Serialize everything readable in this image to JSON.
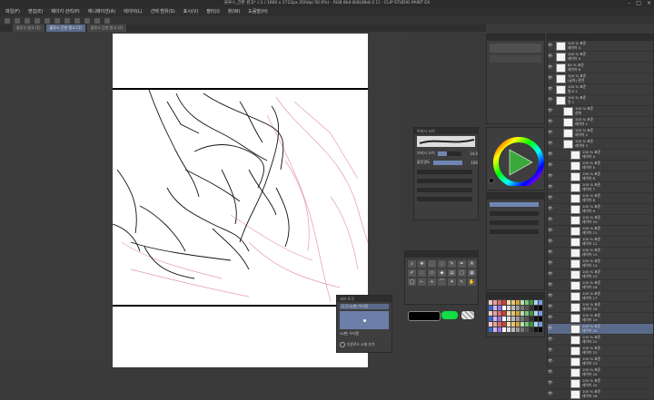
{
  "window": {
    "title": "블루스_간판 원고* (-1 / 1600 x 2712px 350dpi 50.0%) - RGB 8bit B(8)/8bit-2 C) - CLIP STUDIO PAINT EX"
  },
  "menu": [
    "파일(F)",
    "편집(E)",
    "페이지 관리(P)",
    "애니메이션(A)",
    "레이어(L)",
    "선택 범위(S)",
    "표시(V)",
    "필터(I)",
    "창(W)",
    "도움말(H)"
  ],
  "doc_tabs": [
    "블루스 원고 (1)",
    "블루스 간판 원고 (1)",
    "블루스 간판 원고 (2)"
  ],
  "brush_panel": {
    "title": "브러시 크기",
    "size_label": "브러시 크기",
    "size_value": "14.0",
    "size_fill": 0.4,
    "opacity_label": "불투명도",
    "opacity_value": "100"
  },
  "color_panel": {
    "ring_colors": [
      "#ff0000",
      "#ffff00",
      "#00ff00",
      "#00ffff",
      "#0000ff",
      "#ff00ff",
      "#ff0000"
    ],
    "main_color": "#3aa83a"
  },
  "subtool": {
    "title": "서브 도구",
    "item1": "G펜",
    "item2": "G펜 (펜 로고)"
  },
  "preview": {
    "title": "서브 도구",
    "label1": "도구 G(펜) 우리용",
    "label2": "G(펜) 우리용",
    "check": "다운로드 소재 추가"
  },
  "layers": [
    {
      "name": "100 % 표준",
      "sub": "레이어 4"
    },
    {
      "name": "100 % 표준",
      "sub": "레이어 5"
    },
    {
      "name": "84 % 표준",
      "sub": "레이어 6"
    },
    {
      "name": "100 % 표준",
      "sub": "(글자) 관련"
    },
    {
      "name": "100 % 표준",
      "sub": "원고 1"
    },
    {
      "name": "100 % 표준",
      "sub": "컷 1"
    },
    {
      "name": "100 % 표준",
      "sub": "선화"
    },
    {
      "name": "100 % 표준",
      "sub": "레이어 1"
    },
    {
      "name": "100 % 표준",
      "sub": "레이어 2"
    },
    {
      "name": "100 % 표준",
      "sub": "레이어 3"
    },
    {
      "name": "100 % 표준",
      "sub": "레이어 4"
    },
    {
      "name": "100 % 표준",
      "sub": "레이어 5"
    },
    {
      "name": "100 % 표준",
      "sub": "레이어 6"
    },
    {
      "name": "100 % 표준",
      "sub": "레이어 7"
    },
    {
      "name": "100 % 표준",
      "sub": "레이어 8"
    },
    {
      "name": "100 % 표준",
      "sub": "레이어 9"
    },
    {
      "name": "100 % 표준",
      "sub": "레이어 10"
    },
    {
      "name": "100 % 표준",
      "sub": "레이어 11"
    },
    {
      "name": "100 % 표준",
      "sub": "레이어 12"
    },
    {
      "name": "100 % 표준",
      "sub": "레이어 13"
    },
    {
      "name": "100 % 표준",
      "sub": "레이어 14"
    },
    {
      "name": "100 % 표준",
      "sub": "레이어 15"
    },
    {
      "name": "100 % 표준",
      "sub": "레이어 16"
    },
    {
      "name": "100 % 표준",
      "sub": "레이어 17"
    },
    {
      "name": "100 % 표준",
      "sub": "레이어 18"
    },
    {
      "name": "100 % 표준",
      "sub": "레이어 19"
    },
    {
      "name": "100 % 표준",
      "sub": "레이어 20"
    },
    {
      "name": "100 % 표준",
      "sub": "레이어 21"
    },
    {
      "name": "100 % 표준",
      "sub": "레이어 22"
    },
    {
      "name": "100 % 표준",
      "sub": "레이어 23"
    },
    {
      "name": "100 % 표준",
      "sub": "레이어 24"
    },
    {
      "name": "100 % 표준",
      "sub": "레이어 25"
    },
    {
      "name": "100 % 표준",
      "sub": "레이어 26"
    }
  ]
}
